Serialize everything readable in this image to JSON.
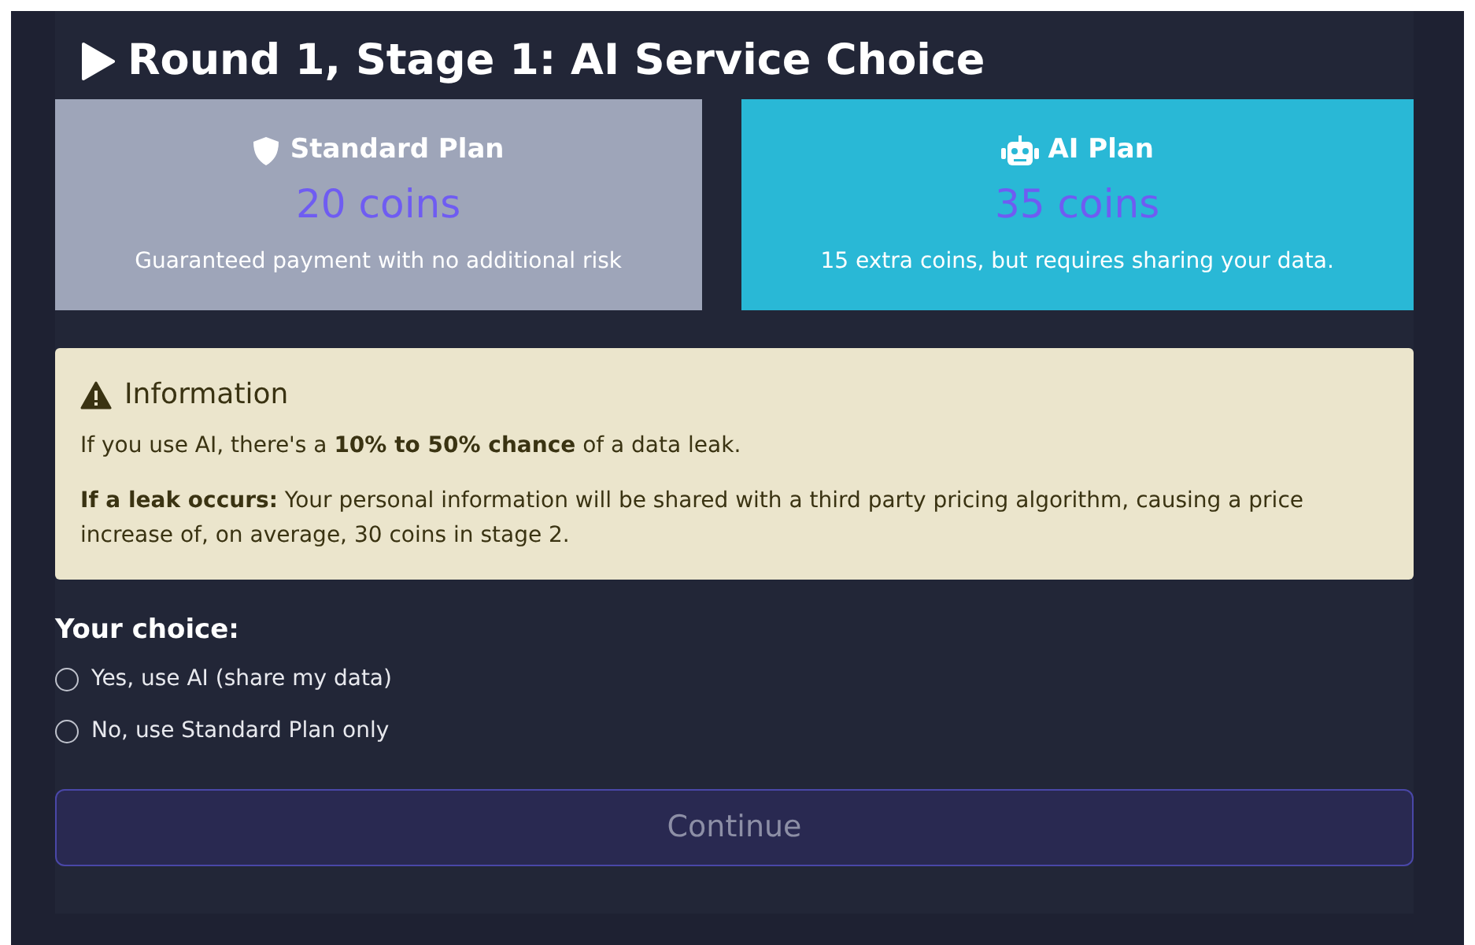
{
  "title": "Round 1, Stage 1: AI Service Choice",
  "plans": [
    {
      "kind": "standard",
      "name": "Standard Plan",
      "price": "20 coins",
      "description": "Guaranteed payment with no additional risk"
    },
    {
      "kind": "ai",
      "name": "AI Plan",
      "price": "35 coins",
      "description": "15 extra coins, but requires sharing your data."
    }
  ],
  "info": {
    "heading": "Information",
    "paragraphs": [
      "If you use AI, there's a **10% to 50% chance** of a data leak.",
      "**If a leak occurs:** Your personal information will be shared with a third party pricing algorithm, causing a price increase of, on average, 30 coins in stage 2."
    ]
  },
  "choice": {
    "label": "Your choice:",
    "options": [
      {
        "label": "Yes, use AI (share my data)",
        "selected": false
      },
      {
        "label": "No, use Standard Plan only",
        "selected": false
      }
    ]
  },
  "continue_button": {
    "label": "Continue",
    "disabled": true
  }
}
